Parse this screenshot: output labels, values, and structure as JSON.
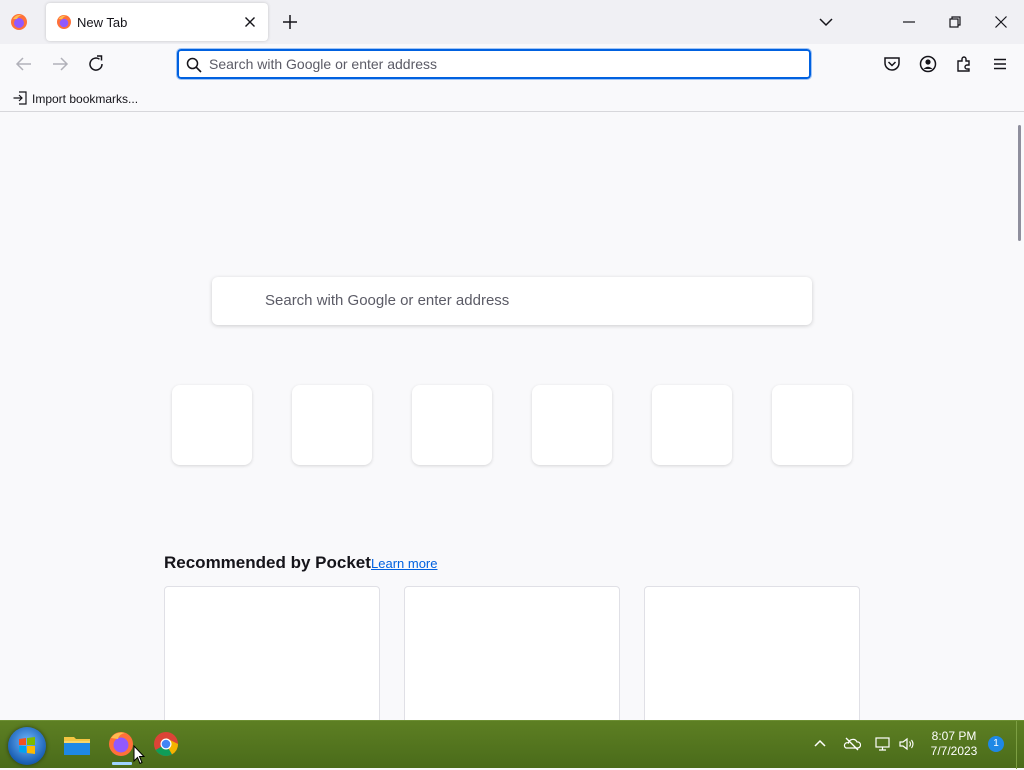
{
  "browser": {
    "tab": {
      "title": "New Tab"
    },
    "urlbar": {
      "placeholder": "Search with Google or enter address"
    },
    "bookmarks": {
      "import_label": "Import bookmarks..."
    }
  },
  "newtab": {
    "search_placeholder": "Search with Google or enter address",
    "shortcut_count": 6,
    "pocket": {
      "title": "Recommended by Pocket",
      "learn_more": "Learn more"
    }
  },
  "taskbar": {
    "time": "8:07 PM",
    "date": "7/7/2023",
    "notification_count": "1"
  },
  "colors": {
    "accent": "#0061e0",
    "taskbar": "#5d7f23"
  }
}
